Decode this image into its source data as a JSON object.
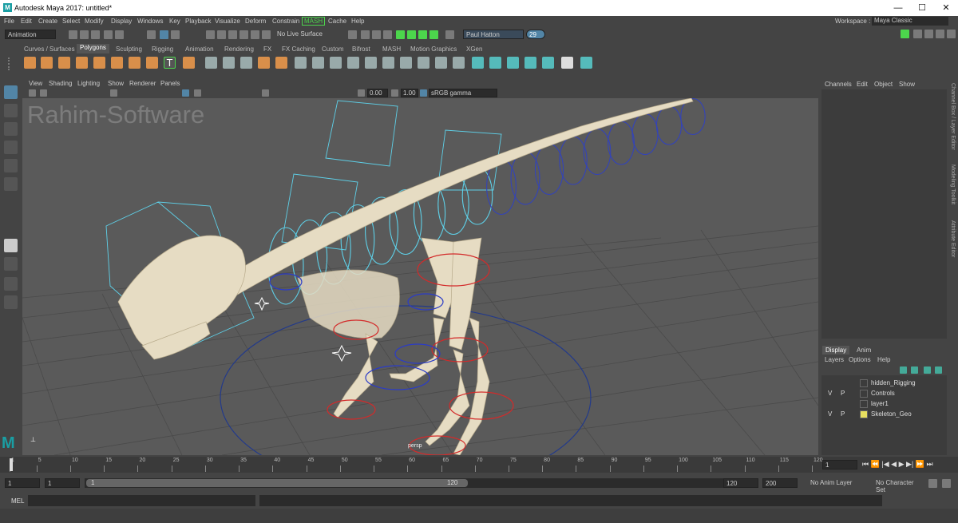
{
  "window": {
    "title": "Autodesk Maya 2017: untitled*",
    "minimize": "—",
    "maximize": "☐",
    "close": "✕"
  },
  "menubar": {
    "items": [
      "File",
      "Edit",
      "Create",
      "Select",
      "Modify",
      "Display",
      "Windows",
      "Key",
      "Playback",
      "Visualize",
      "Deform",
      "Constrain",
      "MASH",
      "Cache",
      "Help"
    ],
    "workspace_label": "Workspace :",
    "workspace_value": "Maya Classic"
  },
  "statusbar": {
    "menuset": "Animation",
    "live_surface": "No Live Surface",
    "user": "Paul Hatton",
    "notifications": "29"
  },
  "shelf": {
    "tabs": [
      "Curves / Surfaces",
      "Polygons",
      "Sculpting",
      "Rigging",
      "Animation",
      "Rendering",
      "FX",
      "FX Caching",
      "Custom",
      "Bifrost",
      "MASH",
      "Motion Graphics",
      "XGen"
    ],
    "active_tab": "Polygons"
  },
  "viewport": {
    "menu": [
      "View",
      "Shading",
      "Lighting",
      "Show",
      "Renderer",
      "Panels"
    ],
    "exposure": "0.00",
    "gamma": "1.00",
    "colorspace": "sRGB gamma",
    "watermark": "Rahim-Software",
    "camera_label": "persp"
  },
  "channel_box": {
    "menu": [
      "Channels",
      "Edit",
      "Object",
      "Show"
    ]
  },
  "layer_editor": {
    "tabs": [
      "Display",
      "Anim"
    ],
    "active_tab": "Display",
    "menu": [
      "Layers",
      "Options",
      "Help"
    ],
    "layers": [
      {
        "v": "",
        "p": "",
        "name": "hidden_Rigging",
        "color": ""
      },
      {
        "v": "V",
        "p": "P",
        "name": "Controls",
        "color": ""
      },
      {
        "v": "",
        "p": "",
        "name": "layer1",
        "color": ""
      },
      {
        "v": "V",
        "p": "P",
        "name": "Skeleton_Geo",
        "color": "#e8e060"
      }
    ]
  },
  "side_tabs": [
    "Channel Box / Layer Editor",
    "Modeling Toolkit",
    "Attribute Editor"
  ],
  "timeline": {
    "ticks": [
      "1",
      "5",
      "10",
      "15",
      "20",
      "25",
      "30",
      "35",
      "40",
      "45",
      "50",
      "55",
      "60",
      "65",
      "70",
      "75",
      "80",
      "85",
      "90",
      "95",
      "100",
      "105",
      "110",
      "115",
      "120"
    ],
    "current_frame": "1"
  },
  "range": {
    "start": "1",
    "anim_start": "1",
    "slider_start": "1",
    "slider_end": "120",
    "anim_end": "120",
    "end": "200",
    "anim_layer": "No Anim Layer",
    "character_set": "No Character Set"
  },
  "command": {
    "type": "MEL"
  },
  "colors": {
    "accent": "#5285a6",
    "maya_logo": "#1a9ea3",
    "bone": "#e6dcc3"
  }
}
